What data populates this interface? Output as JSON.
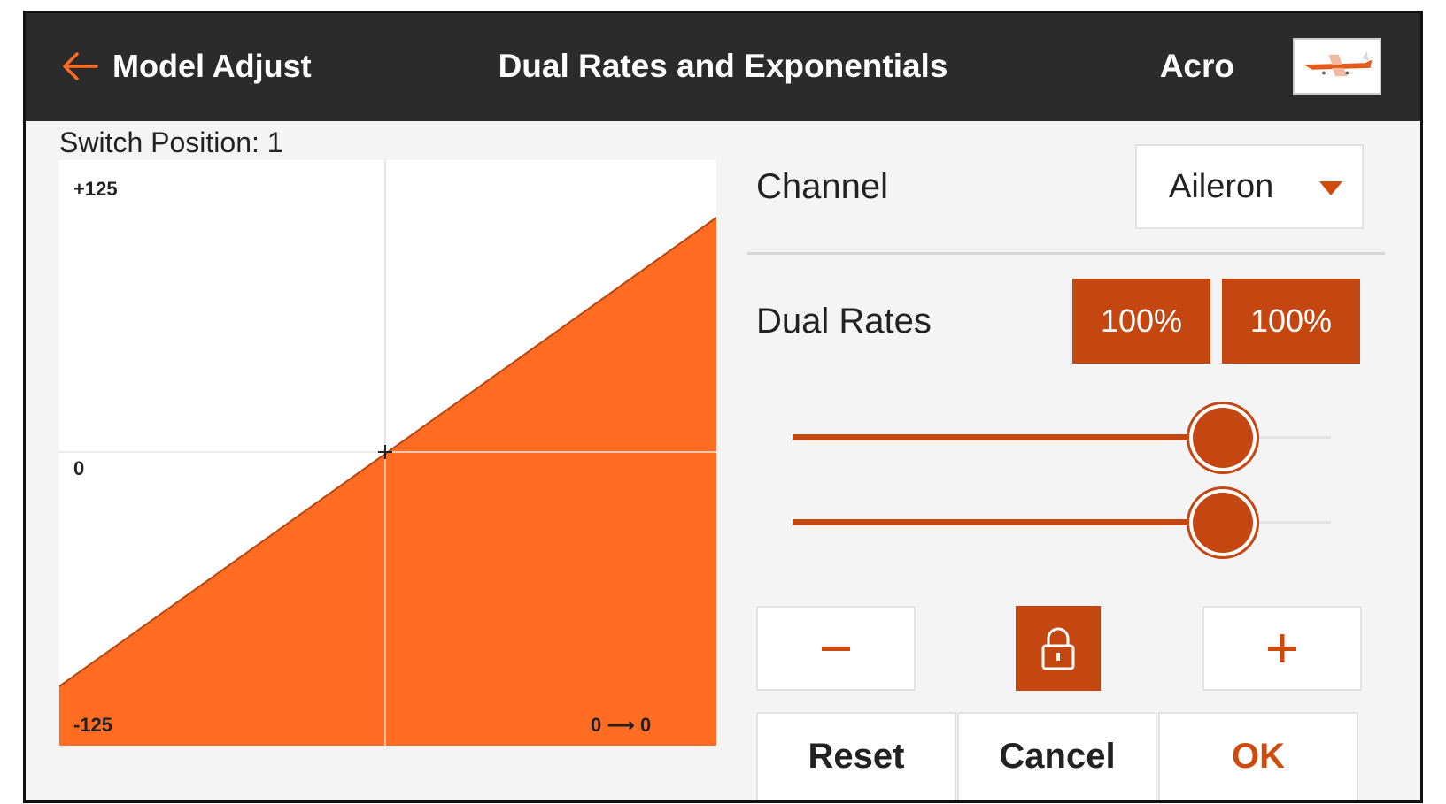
{
  "header": {
    "back_label": "Model Adjust",
    "title": "Dual Rates and Exponentials",
    "model_name": "Acro"
  },
  "graph": {
    "switch_position_label": "Switch Position: 1",
    "y_max_label": "+125",
    "y_zero_label": "0",
    "y_min_label": "-125",
    "readout": "0 ⟶ 0",
    "fill_color": "#ff6c22"
  },
  "channel": {
    "label": "Channel",
    "selected": "Aileron"
  },
  "dual_rates": {
    "label": "Dual Rates",
    "rate_1": "100%",
    "rate_2": "100%"
  },
  "sliders": {
    "rate_1_fraction": 0.8,
    "rate_2_fraction": 0.8
  },
  "actions": {
    "reset_label": "Reset",
    "cancel_label": "Cancel",
    "ok_label": "OK"
  },
  "colors": {
    "accent": "#c44610",
    "header_bg": "#2b2b2b",
    "ok_text": "#cf4a0d"
  },
  "icons": {
    "back": "arrow-left-icon",
    "caret": "caret-down-icon",
    "minus": "minus-icon",
    "lock": "lock-icon",
    "plus": "plus-icon"
  }
}
